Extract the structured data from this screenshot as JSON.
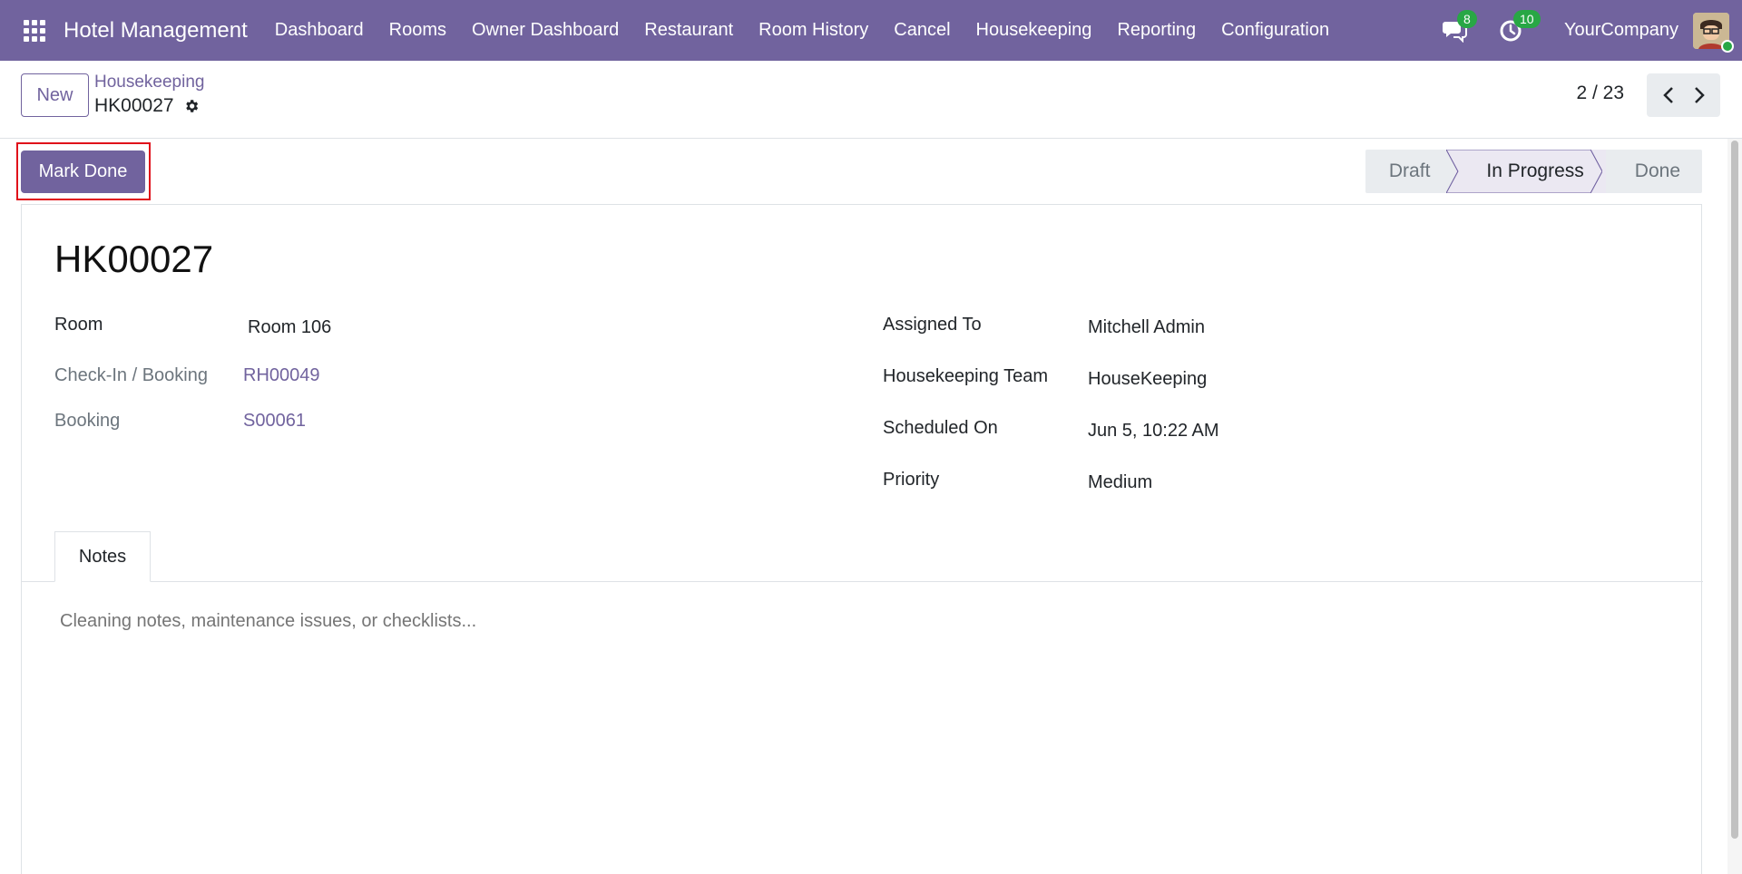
{
  "navbar": {
    "brand": "Hotel Management",
    "menu": [
      "Dashboard",
      "Rooms",
      "Owner Dashboard",
      "Restaurant",
      "Room History",
      "Cancel",
      "Housekeeping",
      "Reporting",
      "Configuration"
    ],
    "messages_count": "8",
    "activities_count": "10",
    "company": "YourCompany",
    "color": "#71639e"
  },
  "control": {
    "new_label": "New",
    "breadcrumb": "Housekeeping",
    "record_name": "HK00027",
    "pager": "2 / 23"
  },
  "statusbar": {
    "action_label": "Mark Done",
    "stages": [
      "Draft",
      "In Progress",
      "Done"
    ],
    "active_stage": "In Progress"
  },
  "form": {
    "title": "HK00027",
    "room_label": "Room",
    "room_value": "Room 106",
    "checkin_label": "Check-In / Booking",
    "checkin_value": "RH00049",
    "booking_label": "Booking",
    "booking_value": "S00061",
    "assigned_label": "Assigned To",
    "assigned_value": "Mitchell Admin",
    "team_label": "Housekeeping Team",
    "team_value": "HouseKeeping",
    "scheduled_label": "Scheduled On",
    "scheduled_value": "Jun 5, 10:22 AM",
    "priority_label": "Priority",
    "priority_value": "Medium"
  },
  "notes": {
    "tab_label": "Notes",
    "placeholder": "Cleaning notes, maintenance issues, or checklists..."
  },
  "icons": {
    "apps": "apps-grid-icon",
    "messages": "chat-icon",
    "activities": "clock-icon",
    "settings": "gear-icon",
    "prev": "chevron-left-icon",
    "next": "chevron-right-icon"
  }
}
